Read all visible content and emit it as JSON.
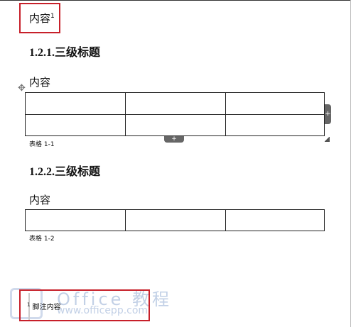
{
  "page": {
    "top_content": "内容",
    "top_content_sup": "1",
    "heading1": "1.2.1.三级标题",
    "content1": "内容",
    "caption1": "表格 1-1",
    "heading2": "1.2.2.三级标题",
    "content2": "内容",
    "caption2": "表格 1-2"
  },
  "table1": {
    "rows": 2,
    "cols": 3,
    "add_column_icon": "+",
    "add_row_icon": "+",
    "move_icon": "✥"
  },
  "table2": {
    "rows": 1,
    "cols": 3
  },
  "footnote": {
    "marker": "1",
    "text": "脚注内容"
  },
  "watermark": {
    "title": "Office 教程",
    "url": "www.officepp.com"
  },
  "colors": {
    "highlight_border": "#c7202a",
    "table_border": "#222222",
    "watermark": "#7896c8"
  }
}
